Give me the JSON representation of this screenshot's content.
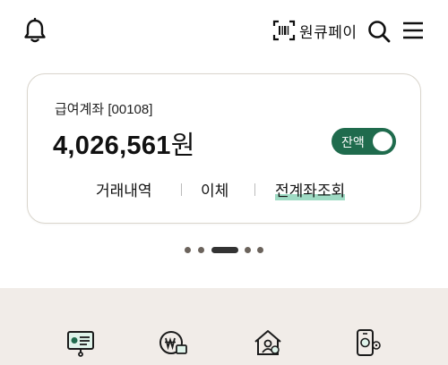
{
  "header": {
    "pay_label": "원큐페이",
    "icons": [
      "bell-icon",
      "barcode-icon",
      "search-icon",
      "menu-icon"
    ]
  },
  "account": {
    "name": "급여계좌 [00108]",
    "balance_amount": "4,026,561",
    "balance_unit": "원",
    "toggle_label": "잔액",
    "toggle_on": true
  },
  "actions": [
    {
      "label": "거래내역"
    },
    {
      "label": "이체"
    },
    {
      "label": "전계좌조회"
    }
  ],
  "carousel": {
    "count": 5,
    "active_index": 2
  },
  "quick_menu": [
    {
      "icon": "presentation-icon"
    },
    {
      "icon": "currency-card-icon"
    },
    {
      "icon": "home-person-icon"
    },
    {
      "icon": "phone-gear-icon"
    }
  ],
  "colors": {
    "accent": "#1f6b4d",
    "highlight": "#7fcfb0",
    "bottom_bg": "#f1ece8",
    "card_border": "#d9d5cc"
  }
}
